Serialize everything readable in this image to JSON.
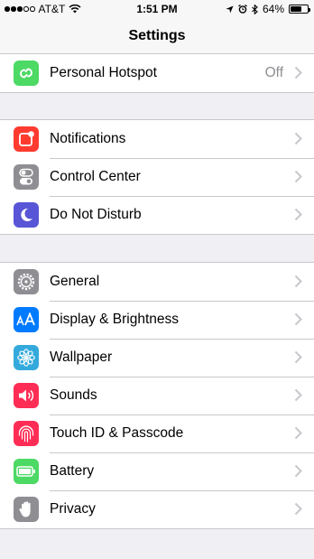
{
  "status_bar": {
    "carrier": "AT&T",
    "time": "1:51 PM",
    "battery_percent_text": "64%",
    "battery_level": 0.64,
    "signal_bars_filled": 3,
    "signal_bars_total": 5
  },
  "nav": {
    "title": "Settings"
  },
  "groups": [
    [
      {
        "label": "Personal Hotspot",
        "value": "Off",
        "icon": "hotspot-icon",
        "color": "#4cd964"
      }
    ],
    [
      {
        "label": "Notifications",
        "icon": "notifications-icon",
        "color": "#ff3b30"
      },
      {
        "label": "Control Center",
        "icon": "control-center-icon",
        "color": "#8e8e93"
      },
      {
        "label": "Do Not Disturb",
        "icon": "moon-icon",
        "color": "#5856d6"
      }
    ],
    [
      {
        "label": "General",
        "icon": "gear-icon",
        "color": "#8e8e93"
      },
      {
        "label": "Display & Brightness",
        "icon": "text-size-icon",
        "color": "#007aff"
      },
      {
        "label": "Wallpaper",
        "icon": "flower-icon",
        "color": "#34aadc"
      },
      {
        "label": "Sounds",
        "icon": "speaker-icon",
        "color": "#ff2d55"
      },
      {
        "label": "Touch ID & Passcode",
        "icon": "fingerprint-icon",
        "color": "#ff2d55"
      },
      {
        "label": "Battery",
        "icon": "battery-icon",
        "color": "#4cd964"
      },
      {
        "label": "Privacy",
        "icon": "hand-icon",
        "color": "#8e8e93"
      }
    ]
  ]
}
